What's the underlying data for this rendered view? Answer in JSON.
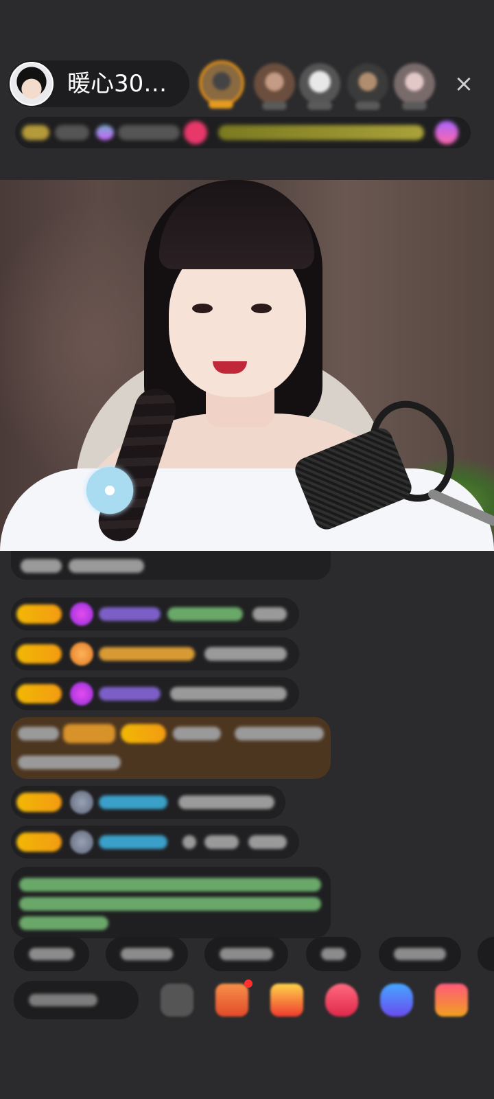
{
  "host": {
    "name": "暖心30…",
    "avatar_icon": "host-avatar"
  },
  "top_bar": {
    "viewer_avatars": [
      "viewer-avatar-1",
      "viewer-avatar-2",
      "viewer-avatar-3",
      "viewer-avatar-4",
      "viewer-avatar-5"
    ],
    "close_label": "×"
  },
  "video": {
    "description_icon": "live-video-stream"
  },
  "colors": {
    "background": "#2b2b2d",
    "level_badge": "#f2b705",
    "gift_message_bg": "#4d3620",
    "notice_text": "#6aa86a"
  },
  "toolbar": {
    "icons": [
      "emoji-icon",
      "shop-icon",
      "gift-box-icon",
      "heart-icon",
      "game-icon",
      "more-gifts-icon"
    ]
  }
}
